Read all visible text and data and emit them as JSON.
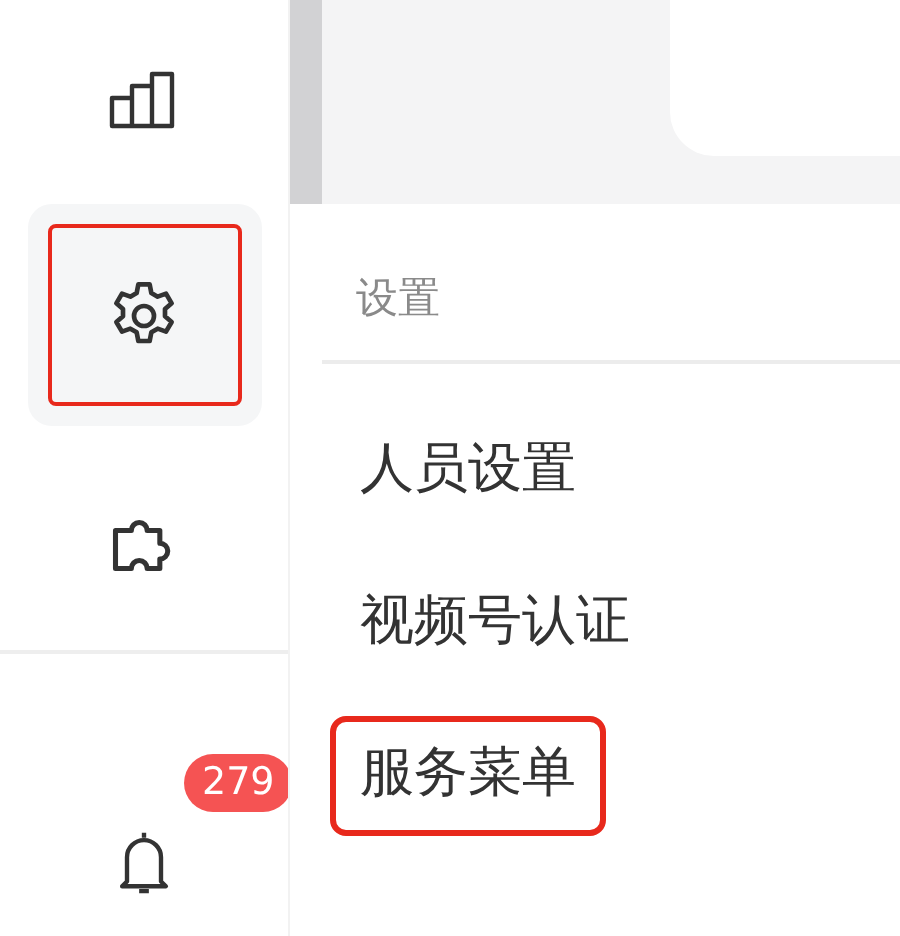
{
  "sidebar": {
    "items": [
      {
        "kind": "chart",
        "selected": false
      },
      {
        "kind": "gear",
        "selected": true
      },
      {
        "kind": "puzzle",
        "selected": false
      },
      {
        "kind": "bell",
        "selected": false,
        "badge": "279"
      }
    ]
  },
  "menu": {
    "header": "设置",
    "items": [
      {
        "label": "人员设置",
        "highlighted": false
      },
      {
        "label": "视频号认证",
        "highlighted": false
      },
      {
        "label": "服务菜单",
        "highlighted": true
      }
    ]
  }
}
